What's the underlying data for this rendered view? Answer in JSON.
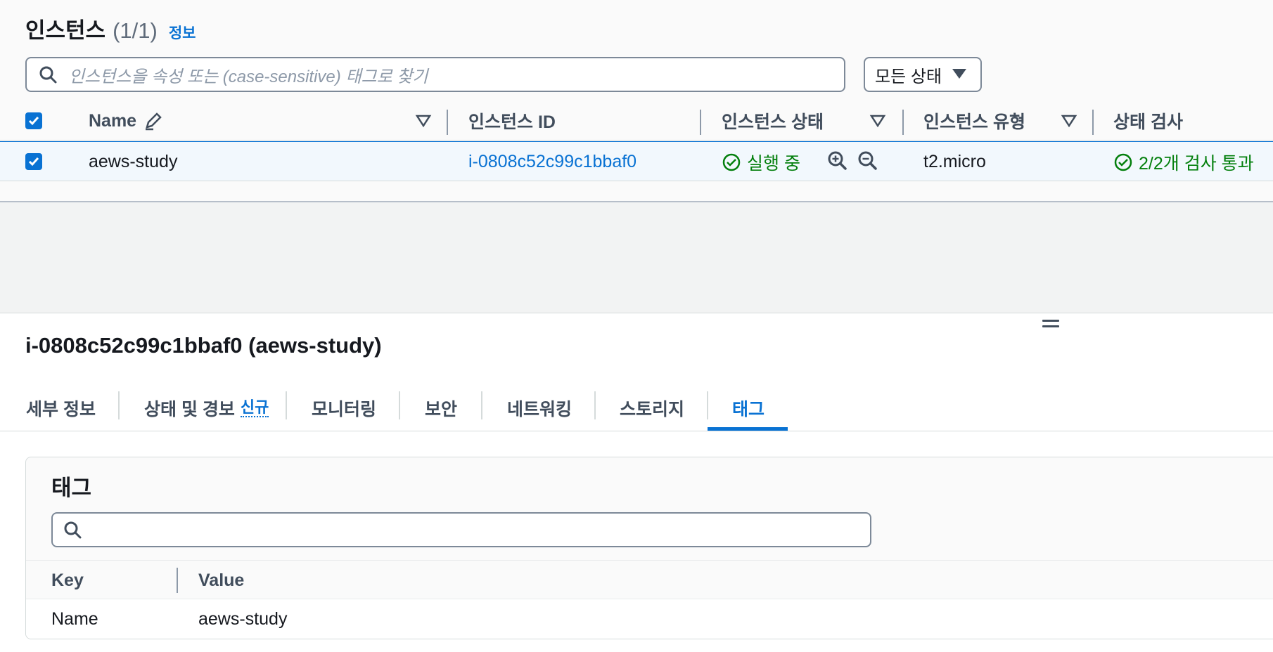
{
  "header": {
    "title": "인스턴스",
    "count": "(1/1)",
    "info_link": "정보"
  },
  "search": {
    "placeholder": "인스턴스을 속성 또는 (case-sensitive) 태그로 찾기"
  },
  "state_filter": {
    "selected": "모든 상태"
  },
  "table": {
    "columns": {
      "name": "Name",
      "instance_id": "인스턴스 ID",
      "instance_state": "인스턴스 상태",
      "instance_type": "인스턴스 유형",
      "status_check": "상태 검사"
    },
    "rows": [
      {
        "name": "aews-study",
        "instance_id": "i-0808c52c99c1bbaf0",
        "instance_state": "실행 중",
        "instance_type": "t2.micro",
        "status_check": "2/2개 검사 통과"
      }
    ]
  },
  "detail": {
    "title": "i-0808c52c99c1bbaf0 (aews-study)",
    "tabs": [
      {
        "label": "세부 정보"
      },
      {
        "label": "상태 및 경보",
        "badge": "신규"
      },
      {
        "label": "모니터링"
      },
      {
        "label": "보안"
      },
      {
        "label": "네트워킹"
      },
      {
        "label": "스토리지"
      },
      {
        "label": "태그"
      }
    ],
    "active_tab": "태그"
  },
  "tags": {
    "title": "태그",
    "search_placeholder": "",
    "columns": {
      "key": "Key",
      "value": "Value"
    },
    "rows": [
      {
        "key": "Name",
        "value": "aews-study"
      }
    ]
  },
  "colors": {
    "accent": "#0972d3",
    "success": "#037f0c"
  }
}
